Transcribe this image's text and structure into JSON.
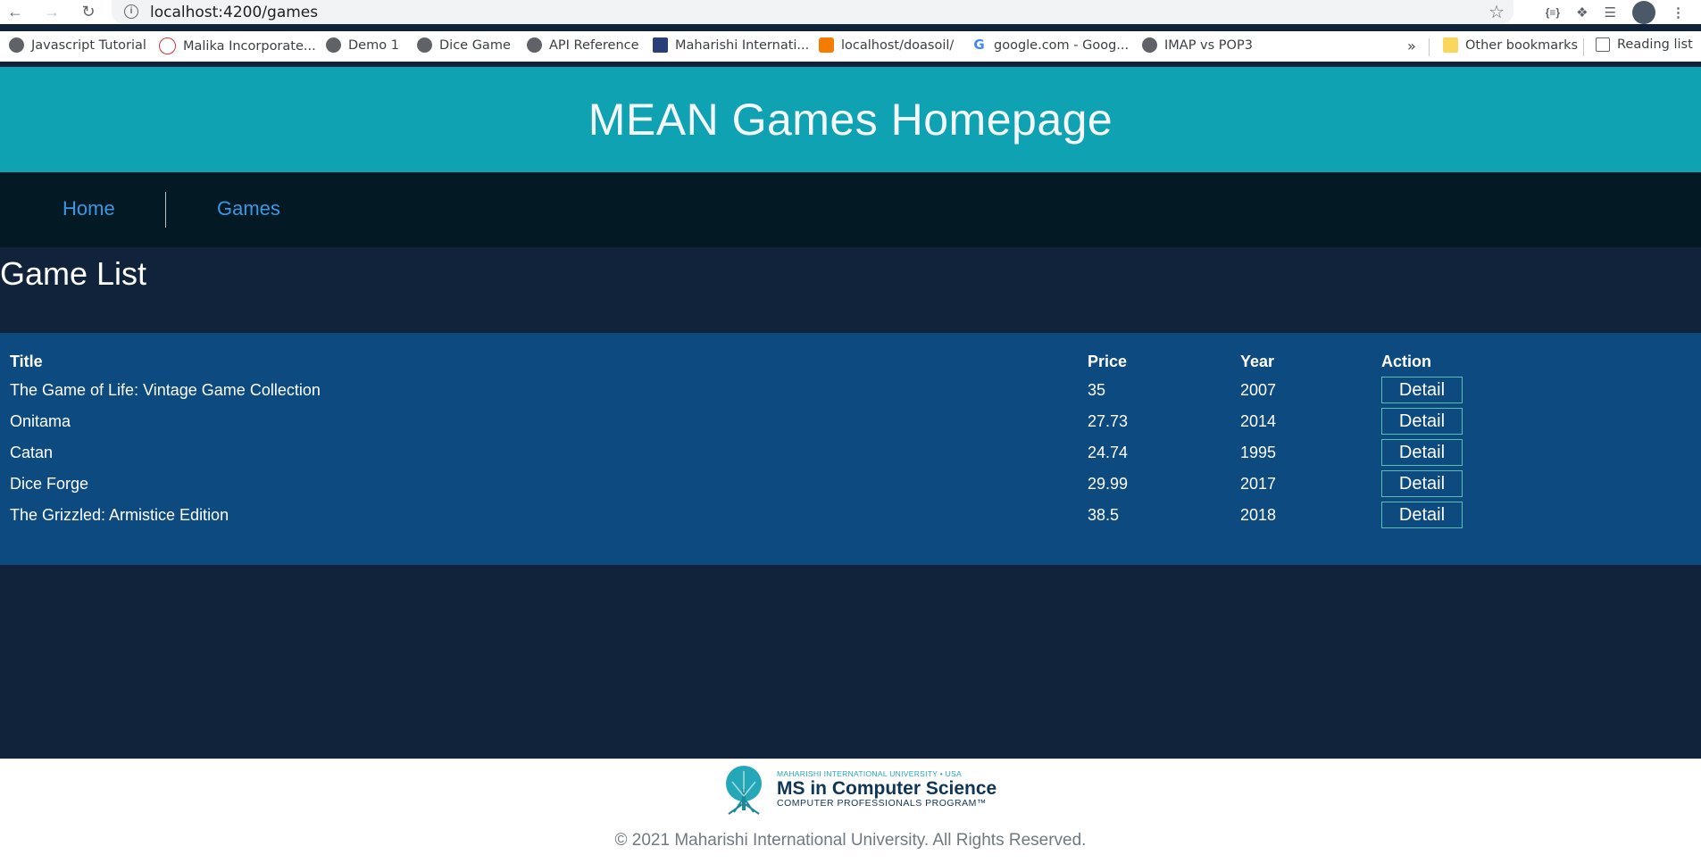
{
  "browser": {
    "url": "localhost:4200/games",
    "bookmarks": [
      {
        "label": "Javascript Tutorial",
        "icon": "globe-icon"
      },
      {
        "label": "Malika Incorporate...",
        "icon": "malika-icon"
      },
      {
        "label": "Demo 1",
        "icon": "globe-icon"
      },
      {
        "label": "Dice Game",
        "icon": "globe-icon"
      },
      {
        "label": "API Reference",
        "icon": "globe-icon"
      },
      {
        "label": "Maharishi Internati...",
        "icon": "se-icon"
      },
      {
        "label": "localhost/doasoil/",
        "icon": "xampp-icon"
      },
      {
        "label": "google.com - Goog...",
        "icon": "google-icon"
      },
      {
        "label": "IMAP vs POP3",
        "icon": "globe-icon"
      }
    ],
    "overflow": "»",
    "other_bookmarks": "Other bookmarks",
    "reading_list": "Reading list"
  },
  "header": {
    "title": "MEAN Games Homepage"
  },
  "nav": {
    "home": "Home",
    "games": "Games"
  },
  "main": {
    "heading": "Game List",
    "columns": [
      "Title",
      "Price",
      "Year",
      "Action"
    ],
    "rows": [
      {
        "title": "The Game of Life: Vintage Game Collection",
        "price": "35",
        "year": "2007",
        "action": "Detail"
      },
      {
        "title": "Onitama",
        "price": "27.73",
        "year": "2014",
        "action": "Detail"
      },
      {
        "title": "Catan",
        "price": "24.74",
        "year": "1995",
        "action": "Detail"
      },
      {
        "title": "Dice Forge",
        "price": "29.99",
        "year": "2017",
        "action": "Detail"
      },
      {
        "title": "The Grizzled: Armistice Edition",
        "price": "38.5",
        "year": "2018",
        "action": "Detail"
      }
    ]
  },
  "footer": {
    "logo_top": "MAHARISHI INTERNATIONAL UNIVERSITY • USA",
    "logo_main": "MS in Computer Science",
    "logo_sub": "COMPUTER PROFESSIONALS PROGRAM™",
    "copyright": "© 2021 Maharishi International University. All Rights Reserved."
  },
  "colors": {
    "header_bg": "#0ea2b2",
    "nav_bg": "#031a25",
    "page_bg": "#10233a",
    "table_bg": "#0d4a80",
    "link": "#3b96e3"
  }
}
